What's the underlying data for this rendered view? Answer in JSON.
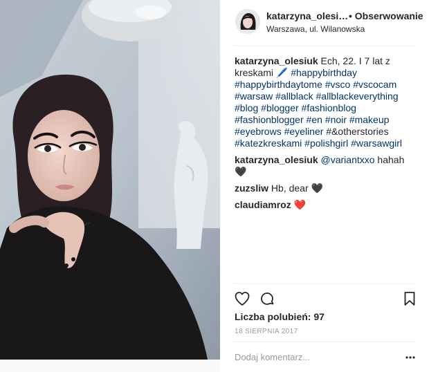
{
  "post": {
    "username": "katarzyna_olesi…",
    "follow_label": "• Obserwowanie",
    "location": "Warszawa, ul. Wilanowska"
  },
  "comments": [
    {
      "user": "katarzyna_olesiuk",
      "text_parts": [
        {
          "t": "Ech, 22. I 7 lat z kreskami 🖊️ ",
          "tag": false
        },
        {
          "t": "#happybirthday",
          "tag": true
        },
        {
          "t": " ",
          "tag": false
        },
        {
          "t": "#happybirthdaytome",
          "tag": true
        },
        {
          "t": " ",
          "tag": false
        },
        {
          "t": "#vsco",
          "tag": true
        },
        {
          "t": " ",
          "tag": false
        },
        {
          "t": "#vscocam",
          "tag": true
        },
        {
          "t": " ",
          "tag": false
        },
        {
          "t": "#warsaw",
          "tag": true
        },
        {
          "t": " ",
          "tag": false
        },
        {
          "t": "#allblack",
          "tag": true
        },
        {
          "t": " ",
          "tag": false
        },
        {
          "t": "#allblackeverything",
          "tag": true
        },
        {
          "t": " ",
          "tag": false
        },
        {
          "t": "#blog",
          "tag": true
        },
        {
          "t": " ",
          "tag": false
        },
        {
          "t": "#blogger",
          "tag": true
        },
        {
          "t": " ",
          "tag": false
        },
        {
          "t": "#fashionblog",
          "tag": true
        },
        {
          "t": " ",
          "tag": false
        },
        {
          "t": "#fashionblogger",
          "tag": true
        },
        {
          "t": " ",
          "tag": false
        },
        {
          "t": "#en",
          "tag": true
        },
        {
          "t": " ",
          "tag": false
        },
        {
          "t": "#noir",
          "tag": true
        },
        {
          "t": " ",
          "tag": false
        },
        {
          "t": "#makeup",
          "tag": true
        },
        {
          "t": " ",
          "tag": false
        },
        {
          "t": "#eyebrows",
          "tag": true
        },
        {
          "t": " ",
          "tag": false
        },
        {
          "t": "#eyeliner",
          "tag": true
        },
        {
          "t": " #&otherstories ",
          "tag": false
        },
        {
          "t": "#katezkreskami",
          "tag": true
        },
        {
          "t": " ",
          "tag": false
        },
        {
          "t": "#polishgirl",
          "tag": true
        },
        {
          "t": " ",
          "tag": false
        },
        {
          "t": "#warsawgirl",
          "tag": true
        }
      ]
    },
    {
      "user": "katarzyna_olesiuk",
      "text_parts": [
        {
          "t": "@variantxxo",
          "tag": true
        },
        {
          "t": " hahah 🖤",
          "tag": false
        }
      ]
    },
    {
      "user": "zuzsliw",
      "text_parts": [
        {
          "t": "Hb, dear 🖤",
          "tag": false
        }
      ]
    },
    {
      "user": "claudiamroz",
      "text_parts": [
        {
          "t": "❤️",
          "tag": false
        }
      ]
    }
  ],
  "actions": {
    "like_icon": "heart-outline-icon",
    "comment_icon": "speech-bubble-icon",
    "save_icon": "bookmark-icon"
  },
  "likes_text": "Liczba polubień: 97",
  "date_text": "18 SIERPNIA 2017",
  "comment_input": {
    "placeholder": "Dodaj komentarz...",
    "value": ""
  },
  "colors": {
    "text": "#262626",
    "hashtag": "#003569",
    "muted": "#999999",
    "divider": "#efefef"
  }
}
